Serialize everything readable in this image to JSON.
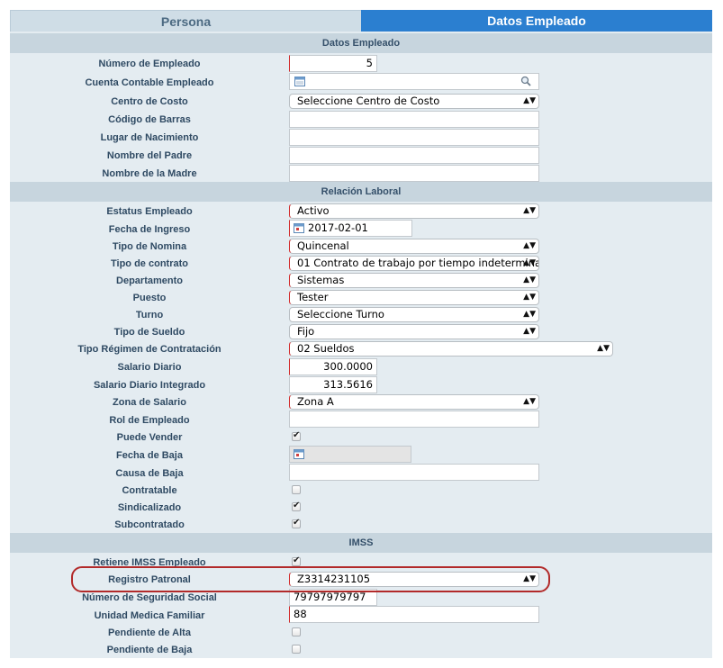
{
  "tabs": {
    "persona": "Persona",
    "datos": "Datos Empleado"
  },
  "sections": {
    "datos_empleado": "Datos Empleado",
    "relacion_laboral": "Relación Laboral",
    "imss": "IMSS"
  },
  "datos": {
    "numero_empleado": {
      "label": "Número de Empleado",
      "value": "5"
    },
    "cuenta_contable": {
      "label": "Cuenta Contable Empleado",
      "value": ""
    },
    "centro_costo": {
      "label": "Centro de Costo",
      "value": "Seleccione Centro de Costo"
    },
    "codigo_barras": {
      "label": "Código de Barras",
      "value": ""
    },
    "lugar_nacimiento": {
      "label": "Lugar de Nacimiento",
      "value": ""
    },
    "nombre_padre": {
      "label": "Nombre del Padre",
      "value": ""
    },
    "nombre_madre": {
      "label": "Nombre de la Madre",
      "value": ""
    }
  },
  "relacion": {
    "estatus": {
      "label": "Estatus Empleado",
      "value": "Activo"
    },
    "fecha_ingreso": {
      "label": "Fecha de Ingreso",
      "value": "2017-02-01"
    },
    "tipo_nomina": {
      "label": "Tipo de Nomina",
      "value": "Quincenal"
    },
    "tipo_contrato": {
      "label": "Tipo de contrato",
      "value": "01 Contrato de trabajo por tiempo indetermina"
    },
    "departamento": {
      "label": "Departamento",
      "value": "Sistemas"
    },
    "puesto": {
      "label": "Puesto",
      "value": "Tester"
    },
    "turno": {
      "label": "Turno",
      "value": "Seleccione Turno"
    },
    "tipo_sueldo": {
      "label": "Tipo de Sueldo",
      "value": "Fijo"
    },
    "regimen": {
      "label": "Tipo Régimen de Contratación",
      "value": "02 Sueldos"
    },
    "salario_diario": {
      "label": "Salario Diario",
      "value": "300.0000"
    },
    "salario_integrado": {
      "label": "Salario Diario Integrado",
      "value": "313.5616"
    },
    "zona_salario": {
      "label": "Zona de Salario",
      "value": "Zona A"
    },
    "rol": {
      "label": "Rol de Empleado",
      "value": ""
    },
    "puede_vender": {
      "label": "Puede Vender",
      "checked": true
    },
    "fecha_baja": {
      "label": "Fecha de Baja",
      "value": ""
    },
    "causa_baja": {
      "label": "Causa de Baja",
      "value": ""
    },
    "contratable": {
      "label": "Contratable",
      "checked": false
    },
    "sindicalizado": {
      "label": "Sindicalizado",
      "checked": true
    },
    "subcontratado": {
      "label": "Subcontratado",
      "checked": true
    }
  },
  "imss": {
    "retiene": {
      "label": "Retiene IMSS Empleado",
      "checked": true
    },
    "registro_patronal": {
      "label": "Registro Patronal",
      "value": "Z3314231105"
    },
    "nss": {
      "label": "Número de Seguridad Social",
      "value": "79797979797"
    },
    "umf": {
      "label": "Unidad Medica Familiar",
      "value": "88"
    },
    "pendiente_alta": {
      "label": "Pendiente de Alta",
      "checked": false
    },
    "pendiente_baja": {
      "label": "Pendiente de Baja",
      "checked": false
    }
  },
  "icons": {
    "calendar": "calendar-icon",
    "search": "search-icon",
    "select_arrows": "select-arrows-icon",
    "check": "checkmark-icon"
  },
  "colors": {
    "active_tab": "#2b7fd0",
    "required_border": "#d22c2c",
    "highlight": "#b22a2a"
  }
}
